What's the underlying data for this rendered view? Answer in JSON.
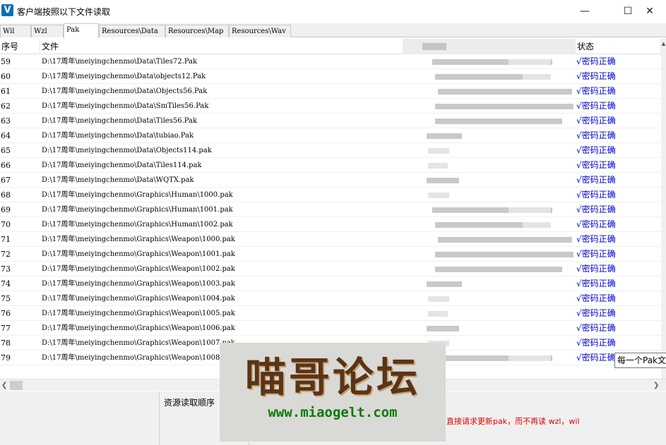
{
  "window": {
    "icon_letter": "V",
    "title": "客户端按照以下文件读取",
    "min": "—",
    "max": "☐",
    "close": "✕"
  },
  "tabs": [
    "Wil",
    "Wzl",
    "Pak",
    "Resources\\Data",
    "Resources\\Map",
    "Resources\\Wav"
  ],
  "active_tab": "Pak",
  "columns": {
    "index": "序号",
    "file": "文件",
    "status": "状态"
  },
  "rows": [
    {
      "index": "59",
      "file": "D:\\17周年\\meiyingchenmo\\Data\\Tiles72.Pak",
      "status": "√密码正确"
    },
    {
      "index": "60",
      "file": "D:\\17周年\\meiyingchenmo\\Data\\objects12.Pak",
      "status": "√密码正确"
    },
    {
      "index": "61",
      "file": "D:\\17周年\\meiyingchenmo\\Data\\Objects56.Pak",
      "status": "√密码正确"
    },
    {
      "index": "62",
      "file": "D:\\17周年\\meiyingchenmo\\Data\\SmTiles56.Pak",
      "status": "√密码正确"
    },
    {
      "index": "63",
      "file": "D:\\17周年\\meiyingchenmo\\Data\\Tiles56.Pak",
      "status": "√密码正确"
    },
    {
      "index": "64",
      "file": "D:\\17周年\\meiyingchenmo\\Data\\tubiao.Pak",
      "status": "√密码正确"
    },
    {
      "index": "65",
      "file": "D:\\17周年\\meiyingchenmo\\Data\\Objects114.pak",
      "status": "√密码正确"
    },
    {
      "index": "66",
      "file": "D:\\17周年\\meiyingchenmo\\Data\\Tiles114.pak",
      "status": "√密码正确"
    },
    {
      "index": "67",
      "file": "D:\\17周年\\meiyingchenmo\\Data\\WQTX.pak",
      "status": "√密码正确"
    },
    {
      "index": "68",
      "file": "D:\\17周年\\meiyingchenmo\\Graphics\\Human\\1000.pak",
      "status": "√密码正确"
    },
    {
      "index": "69",
      "file": "D:\\17周年\\meiyingchenmo\\Graphics\\Human\\1001.pak",
      "status": "√密码正确"
    },
    {
      "index": "70",
      "file": "D:\\17周年\\meiyingchenmo\\Graphics\\Human\\1002.pak",
      "status": "√密码正确"
    },
    {
      "index": "71",
      "file": "D:\\17周年\\meiyingchenmo\\Graphics\\Weapon\\1000.pak",
      "status": "√密码正确"
    },
    {
      "index": "72",
      "file": "D:\\17周年\\meiyingchenmo\\Graphics\\Weapon\\1001.pak",
      "status": "√密码正确"
    },
    {
      "index": "73",
      "file": "D:\\17周年\\meiyingchenmo\\Graphics\\Weapon\\1002.pak",
      "status": "√密码正确"
    },
    {
      "index": "74",
      "file": "D:\\17周年\\meiyingchenmo\\Graphics\\Weapon\\1003.pak",
      "status": "√密码正确"
    },
    {
      "index": "75",
      "file": "D:\\17周年\\meiyingchenmo\\Graphics\\Weapon\\1004.pak",
      "status": "√密码正确"
    },
    {
      "index": "76",
      "file": "D:\\17周年\\meiyingchenmo\\Graphics\\Weapon\\1005.pak",
      "status": "√密码正确"
    },
    {
      "index": "77",
      "file": "D:\\17周年\\meiyingchenmo\\Graphics\\Weapon\\1006.pak",
      "status": "√密码正确"
    },
    {
      "index": "78",
      "file": "D:\\17周年\\meiyingchenmo\\Graphics\\Weapon\\1007.pak",
      "status": "√密码正确"
    },
    {
      "index": "79",
      "file": "D:\\17周年\\meiyingchenmo\\Graphics\\Weapon\\1008.pak",
      "status": "√密码正确"
    }
  ],
  "tooltip": "每一个Pak文",
  "bottom": {
    "load_order_label": "资源读取顺序",
    "notice": "直接请求更新pak，而不再读 wzl，wil"
  },
  "watermark": {
    "title": "喵哥论坛",
    "url": "www.miaogelt.com"
  },
  "colors": {
    "status": "#0000cc",
    "notice": "#e00000",
    "watermark_text": "#5a3418",
    "watermark_url": "#0a7a0a"
  }
}
